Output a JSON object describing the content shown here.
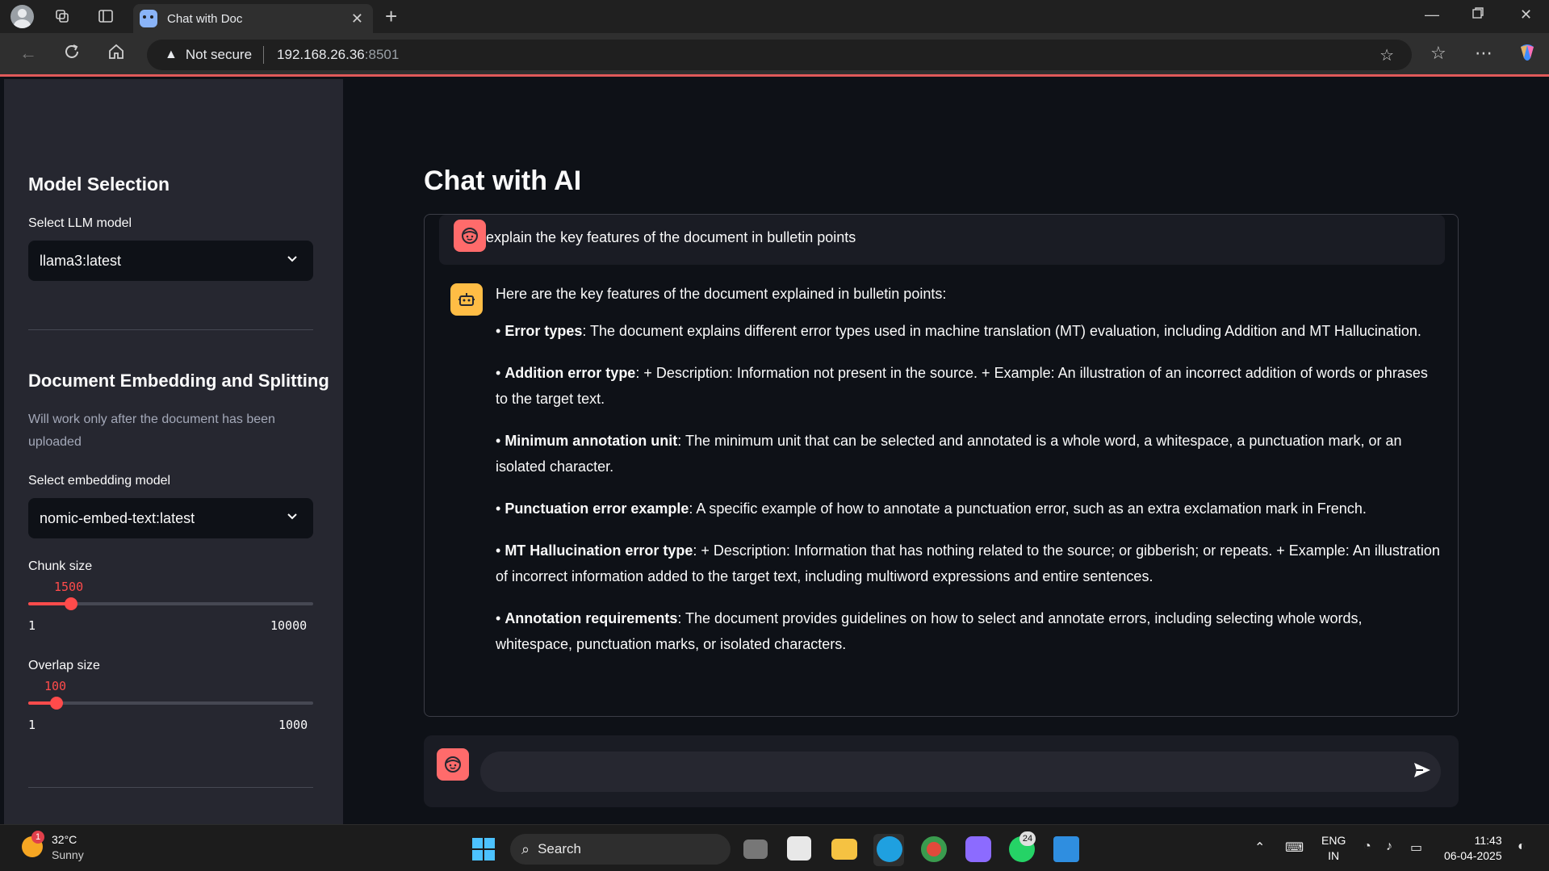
{
  "browser": {
    "tab_title": "Chat with Doc",
    "security_label": "Not secure",
    "url_host": "192.168.26.36",
    "url_port": ":8501"
  },
  "sidebar": {
    "model_section_title": "Model Selection",
    "llm_label": "Select LLM model",
    "llm_value": "llama3:latest",
    "embed_section_title": "Document Embedding and Splitting",
    "embed_note": "Will work only after the document has been uploaded",
    "embed_label": "Select embedding model",
    "embed_value": "nomic-embed-text:latest",
    "chunk": {
      "label": "Chunk size",
      "value": "1500",
      "min": "1",
      "max": "10000",
      "fraction": 0.15
    },
    "overlap": {
      "label": "Overlap size",
      "value": "100",
      "min": "1",
      "max": "1000",
      "fraction": 0.1
    }
  },
  "main": {
    "title": "Chat with AI",
    "user_message": "explain the key features of the document in bulletin points",
    "bot_intro": "Here are the key features of the document explained in bulletin points:",
    "bot_points": [
      {
        "title": "Error types",
        "text": ": The document explains different error types used in machine translation (MT) evaluation, including Addition and MT Hallucination."
      },
      {
        "title": "Addition error type",
        "text": ": + Description: Information not present in the source. + Example: An illustration of an incorrect addition of words or phrases to the target text."
      },
      {
        "title": "Minimum annotation unit",
        "text": ": The minimum unit that can be selected and annotated is a whole word, a whitespace, a punctuation mark, or an isolated character."
      },
      {
        "title": "Punctuation error example",
        "text": ": A specific example of how to annotate a punctuation error, such as an extra exclamation mark in French."
      },
      {
        "title": "MT Hallucination error type",
        "text": ": + Description: Information that has nothing related to the source; or gibberish; or repeats. + Example: An illustration of incorrect information added to the target text, including multiword expressions and entire sentences."
      },
      {
        "title": "Annotation requirements",
        "text": ": The document provides guidelines on how to select and annotate errors, including selecting whole words, whitespace, punctuation marks, or isolated characters."
      }
    ],
    "input_value": ""
  },
  "taskbar": {
    "weather_badge": "1",
    "temperature": "32°C",
    "condition": "Sunny",
    "search_label": "Search",
    "whatsapp_badge": "24",
    "lang_top": "ENG",
    "lang_bottom": "IN",
    "time": "11:43",
    "date": "06-04-2025"
  },
  "colors": {
    "accent": "#ff4b4b",
    "sidebar_bg": "#262730",
    "main_bg": "#0e1117",
    "user_avatar": "#ff6b6b",
    "bot_avatar": "#ffbd45"
  }
}
